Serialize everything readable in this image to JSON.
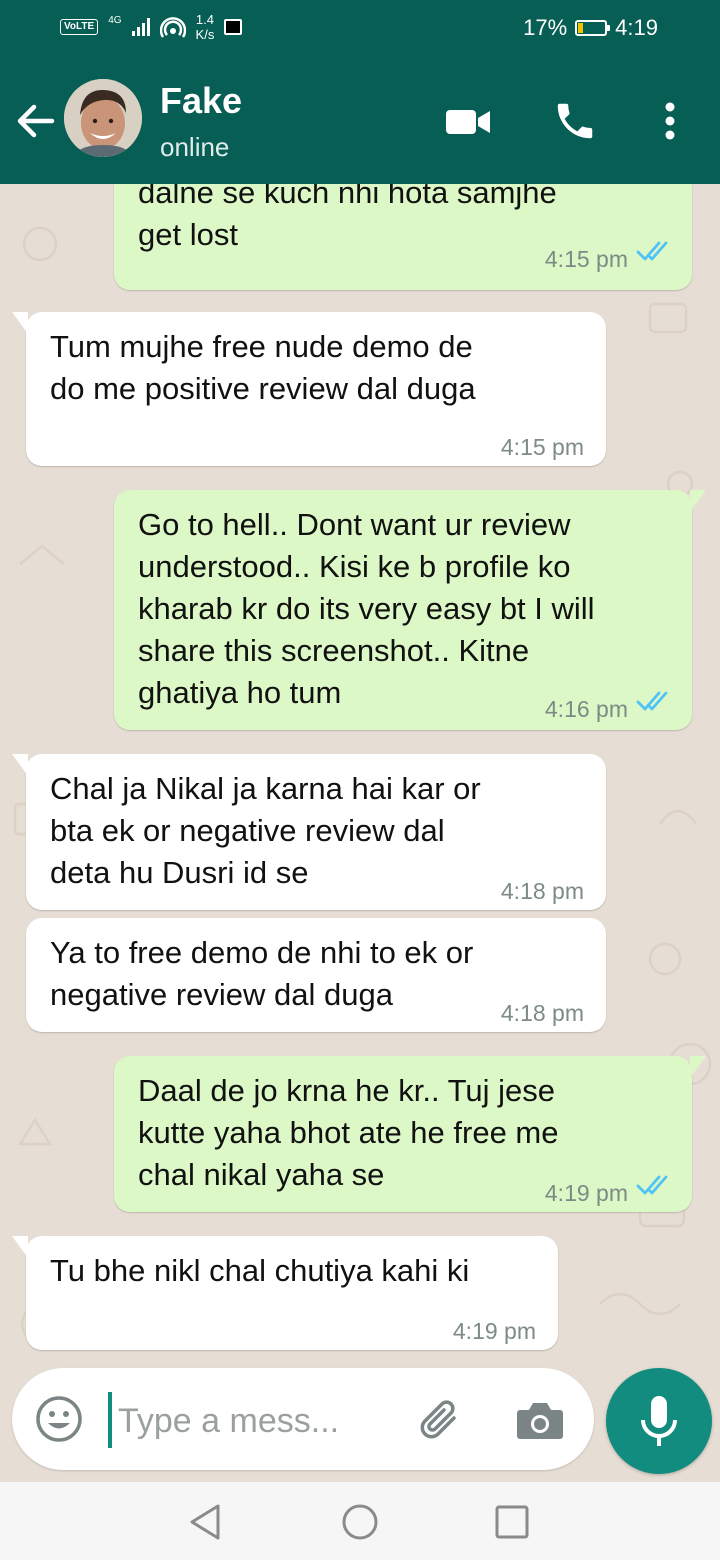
{
  "status_bar": {
    "volte": "VoLTE",
    "network": "4G",
    "data_speed_value": "1.4",
    "data_speed_unit": "K/s",
    "battery_percent": "17%",
    "battery_level": 0.17,
    "time": "4:19",
    "colors": {
      "background": "#075e54",
      "battery_fill": "#f3c200"
    }
  },
  "header": {
    "contact_name": "Fake",
    "contact_status": "online",
    "icons": {
      "back": "arrow-left-icon",
      "video": "video-camera-icon",
      "call": "phone-icon",
      "menu": "more-vertical-icon"
    },
    "colors": {
      "background": "#075e54"
    }
  },
  "messages": [
    {
      "direction": "out",
      "text": "dalne se kuch nhi hota samjhe\nget lost",
      "time": "4:15 pm",
      "read": true
    },
    {
      "direction": "in",
      "text": "Tum mujhe free nude demo de\ndo me positive review dal duga",
      "time": "4:15 pm"
    },
    {
      "direction": "out",
      "text": "Go to hell.. Dont want ur review\nunderstood.. Kisi ke b profile ko\nkharab kr do its very easy bt I will\nshare this screenshot.. Kitne\nghatiya ho tum",
      "time": "4:16 pm",
      "read": true
    },
    {
      "direction": "in",
      "text": "Chal ja Nikal ja karna hai kar or\nbta ek or negative review dal\ndeta hu Dusri id se",
      "time": "4:18 pm"
    },
    {
      "direction": "in",
      "text": "Ya to free demo de nhi to ek or\nnegative review dal duga",
      "time": "4:18 pm"
    },
    {
      "direction": "out",
      "text": "Daal de jo krna he kr.. Tuj jese\nkutte yaha bhot ate he free me\nchal nikal yaha se",
      "time": "4:19 pm",
      "read": true
    },
    {
      "direction": "in",
      "text": "Tu bhe nikl chal chutiya kahi ki",
      "time": "4:19 pm"
    }
  ],
  "input_bar": {
    "placeholder": "Type a mess...",
    "value": "",
    "icons": {
      "emoji": "emoji-icon",
      "attach": "paperclip-icon",
      "camera": "camera-icon",
      "mic": "microphone-icon"
    },
    "colors": {
      "accent": "#128c7e",
      "read_ticks": "#4fc3f7"
    }
  },
  "nav_bar": {
    "icons": {
      "back": "triangle-back-icon",
      "home": "circle-home-icon",
      "recents": "square-recents-icon"
    }
  },
  "colors": {
    "chat_background": "#e6ddd4",
    "outgoing_bubble": "#dcf8c6",
    "incoming_bubble": "#ffffff"
  }
}
